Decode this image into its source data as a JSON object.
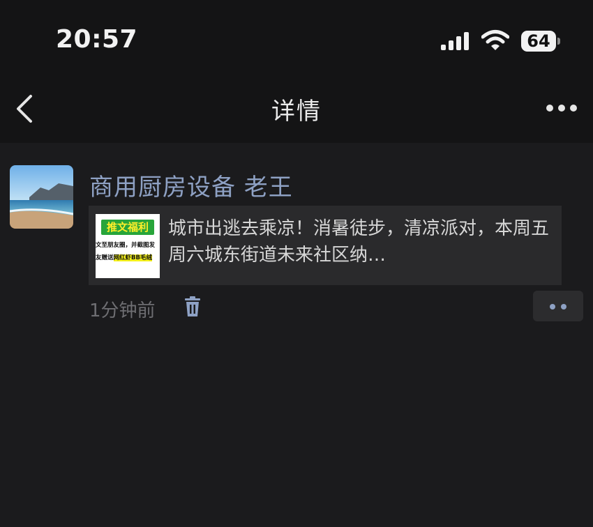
{
  "status_bar": {
    "time": "20:57",
    "battery": "64"
  },
  "nav": {
    "title": "详情"
  },
  "post": {
    "author": "商用厨房设备 老王",
    "time_ago": "1分钟前",
    "link": {
      "text": "城市出逃去乘凉！消暑徒步，清凉派对，本周五周六城东街道未来社区纳…",
      "thumb": {
        "title": "推文福利",
        "line1": "文至朋友圈，并截图发",
        "line2_prefix": "友赠送",
        "line2_highlight": "网红虾BB毛绒"
      }
    }
  },
  "colors": {
    "link_name": "#8ea1c4",
    "background": "#1b1b1d",
    "header": "#141415"
  }
}
